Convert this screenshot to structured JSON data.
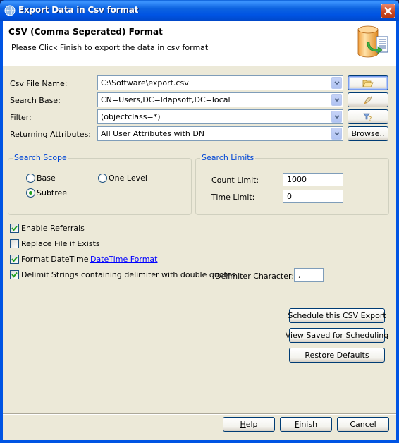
{
  "window": {
    "title": "Export Data in Csv format",
    "app_icon": "globe-icon",
    "close_icon": "close-icon"
  },
  "header": {
    "title": "CSV (Comma Seperated) Format",
    "description": "Please Click Finish to export the data in csv format",
    "icon": "database-export-icon"
  },
  "form": {
    "csv_file_name": {
      "label": "Csv File Name:",
      "value": "C:\\Software\\export.csv",
      "button_icon": "folder-open-icon"
    },
    "search_base": {
      "label": "Search Base:",
      "value": "CN=Users,DC=ldapsoft,DC=local",
      "button_icon": "rocket-icon"
    },
    "filter": {
      "label": "Filter:",
      "value": "(objectclass=*)",
      "button_icon": "filter-icon"
    },
    "returning_attributes": {
      "label": "Returning Attributes:",
      "value": "All User Attributes with DN",
      "button_label": "Browse.."
    }
  },
  "search_scope": {
    "title": "Search Scope",
    "options": [
      {
        "label": "Base",
        "selected": false
      },
      {
        "label": "One Level",
        "selected": false
      },
      {
        "label": "Subtree",
        "selected": true
      }
    ]
  },
  "search_limits": {
    "title": "Search Limits",
    "count_limit_label": "Count Limit:",
    "count_limit_value": "1000",
    "time_limit_label": "Time Limit:",
    "time_limit_value": "0"
  },
  "options": {
    "enable_referrals": {
      "label": "Enable Referrals",
      "checked": true
    },
    "replace_file": {
      "label": "Replace File if Exists",
      "checked": false
    },
    "format_datetime": {
      "label": "Format DateTime",
      "checked": true
    },
    "datetime_format_link": "DateTime Format",
    "delimit_strings": {
      "label": "Delimit Strings containing delimiter with double quotes",
      "checked": true
    },
    "delimiter_label": "Delimiter Character:",
    "delimiter_value": ","
  },
  "actions": {
    "schedule": "Schedule this CSV Export",
    "view_saved": "View Saved for Scheduling",
    "restore_defaults": "Restore Defaults"
  },
  "footer": {
    "help": {
      "mnemonic": "H",
      "rest": "elp"
    },
    "finish": {
      "mnemonic": "F",
      "rest": "inish"
    },
    "cancel": "Cancel"
  }
}
